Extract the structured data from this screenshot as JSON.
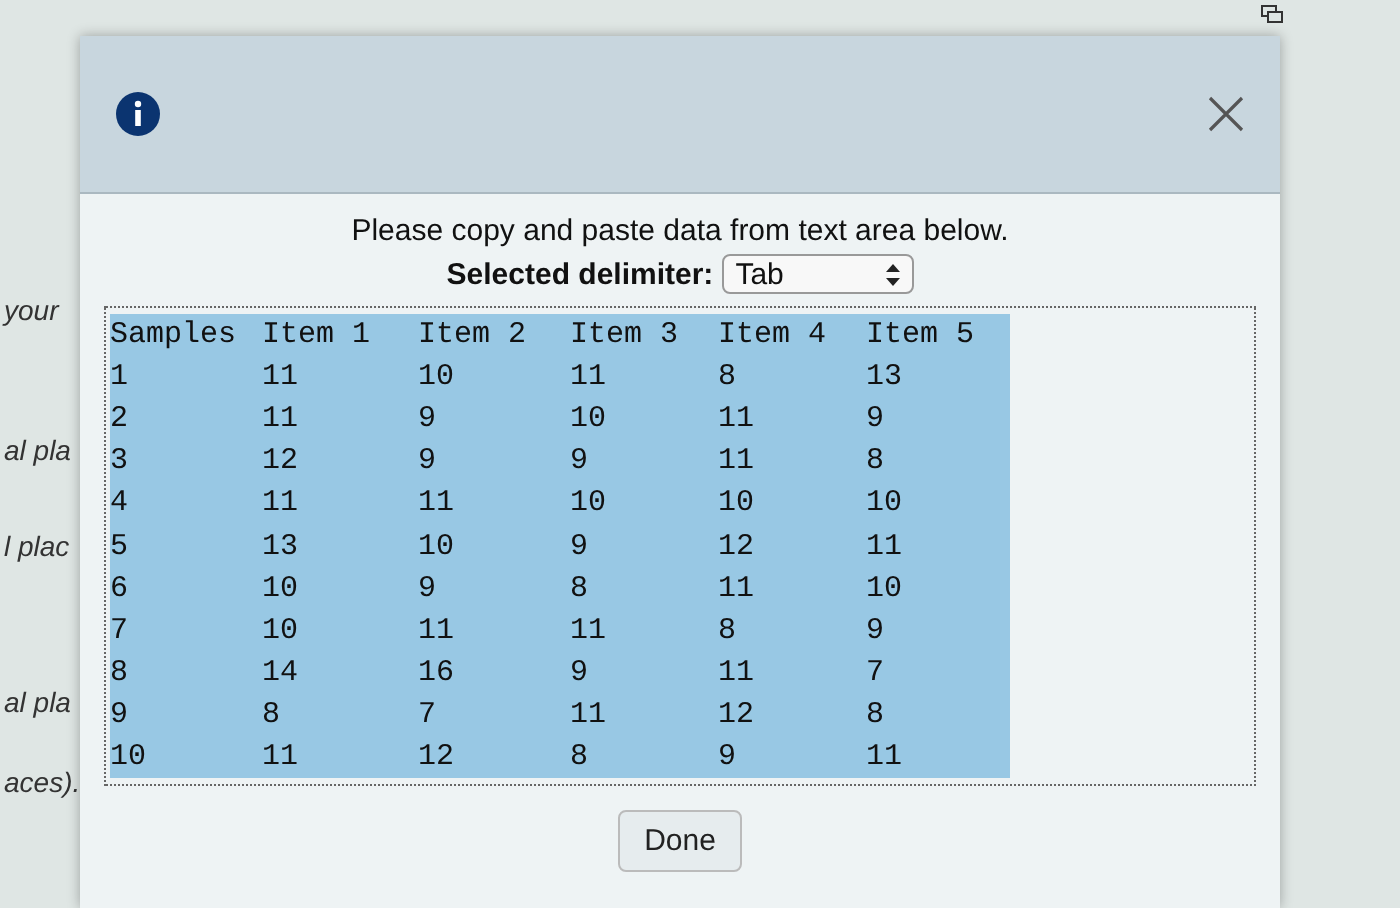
{
  "background_texts": [
    "your",
    "al pla",
    "l plac",
    "al pla",
    "aces)."
  ],
  "dialog": {
    "instruction": "Please copy and paste data from text area below.",
    "delimiter_label": "Selected delimiter:",
    "delimiter_value": "Tab",
    "text_area": {
      "selected": true,
      "header": [
        "Samples",
        "Item 1",
        "Item 2",
        "Item 3",
        "Item 4",
        "Item 5"
      ],
      "rows": [
        [
          "1",
          "11",
          "10",
          "11",
          "8",
          "13"
        ],
        [
          "2",
          "11",
          "9",
          "10",
          "11",
          "9"
        ],
        [
          "3",
          "12",
          "9",
          "9",
          "11",
          "8"
        ],
        [
          "4",
          "11",
          "11",
          "10",
          "10",
          "10"
        ],
        [
          "5",
          "13",
          "10",
          "9",
          "12",
          "11"
        ],
        [
          "6",
          "10",
          "9",
          "8",
          "11",
          "10"
        ],
        [
          "7",
          "10",
          "11",
          "11",
          "8",
          "9"
        ],
        [
          "8",
          "14",
          "16",
          "9",
          "11",
          "7"
        ],
        [
          "9",
          "8",
          "7",
          "11",
          "12",
          "8"
        ],
        [
          "10",
          "11",
          "12",
          "8",
          "9",
          "11"
        ]
      ]
    },
    "done_button": "Done"
  }
}
